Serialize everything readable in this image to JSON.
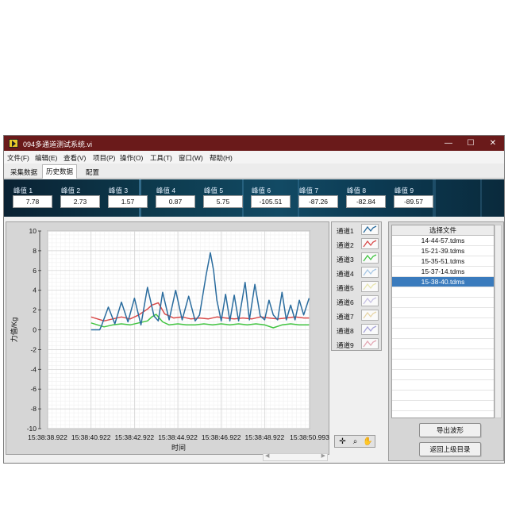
{
  "window": {
    "title": "094多通道测试系统.vi",
    "controls": {
      "minimize": "—",
      "maximize": "☐",
      "close": "✕"
    }
  },
  "menu": [
    "文件(F)",
    "编辑(E)",
    "查看(V)",
    "项目(P)",
    "操作(O)",
    "工具(T)",
    "窗口(W)",
    "帮助(H)"
  ],
  "tabs": [
    {
      "label": "采集数据",
      "active": false
    },
    {
      "label": "历史数据",
      "active": true
    },
    {
      "label": "配置",
      "active": false
    }
  ],
  "peaks": [
    {
      "label": "峰值 1",
      "value": "7.78"
    },
    {
      "label": "峰值 2",
      "value": "2.73"
    },
    {
      "label": "峰值 3",
      "value": "1.57"
    },
    {
      "label": "峰值 4",
      "value": "0.87"
    },
    {
      "label": "峰值 5",
      "value": "5.75"
    },
    {
      "label": "峰值 6",
      "value": "-105.51"
    },
    {
      "label": "峰值 7",
      "value": "-87.26"
    },
    {
      "label": "峰值 8",
      "value": "-82.84"
    },
    {
      "label": "峰值 9",
      "value": "-89.57"
    }
  ],
  "legend": [
    {
      "label": "通道1",
      "color": "#2a6c9e"
    },
    {
      "label": "通道2",
      "color": "#d94b4b"
    },
    {
      "label": "通道3",
      "color": "#42c442"
    },
    {
      "label": "通道4",
      "color": "#a8c8e6"
    },
    {
      "label": "通道5",
      "color": "#e8e6b0"
    },
    {
      "label": "通道6",
      "color": "#c8c2e4"
    },
    {
      "label": "通道7",
      "color": "#e8d6a8"
    },
    {
      "label": "通道8",
      "color": "#a8a4d8"
    },
    {
      "label": "通道9",
      "color": "#e4a8b4"
    }
  ],
  "chart_data": {
    "type": "line",
    "xlabel": "时间",
    "ylabel": "力值/Kg",
    "ylim": [
      -10,
      10
    ],
    "yticks": [
      "10",
      "8",
      "6",
      "4",
      "2",
      "0",
      "-2",
      "-4",
      "-6",
      "-8",
      "-10"
    ],
    "xlim_seconds": [
      0,
      12.071
    ],
    "xtick_labels": [
      "15:38:38.922",
      "15:38:40.922",
      "15:38:42.922",
      "15:38:44.922",
      "15:38:46.922",
      "15:38:48.922",
      "15:38:50.993"
    ],
    "xtick_seconds": [
      0,
      2,
      4,
      6,
      8,
      10,
      12.071
    ],
    "grid": true,
    "series": [
      {
        "name": "通道1",
        "color": "#2a6c9e",
        "x": [
          2.0,
          2.4,
          2.5,
          2.8,
          3.1,
          3.4,
          3.7,
          4.0,
          4.3,
          4.6,
          4.9,
          5.1,
          5.3,
          5.6,
          5.9,
          6.2,
          6.5,
          6.8,
          7.0,
          7.3,
          7.5,
          7.65,
          7.8,
          8.0,
          8.2,
          8.4,
          8.6,
          8.8,
          9.1,
          9.3,
          9.55,
          9.8,
          10.0,
          10.2,
          10.4,
          10.6,
          10.8,
          11.0,
          11.2,
          11.4,
          11.6,
          11.8,
          12.05
        ],
        "y": [
          0,
          0,
          0.5,
          2.3,
          0.6,
          2.8,
          0.8,
          3.2,
          0.5,
          4.3,
          1.4,
          0.9,
          3.8,
          1.0,
          4.0,
          1.0,
          3.4,
          0.9,
          1.5,
          5.5,
          7.8,
          6.0,
          3.0,
          0.9,
          3.6,
          0.9,
          3.5,
          0.9,
          4.8,
          1.0,
          4.6,
          1.4,
          1.0,
          3.0,
          1.5,
          1.0,
          3.8,
          1.0,
          2.5,
          1.0,
          3.0,
          1.5,
          3.2
        ]
      },
      {
        "name": "通道2",
        "color": "#d94b4b",
        "x": [
          2.0,
          2.3,
          2.6,
          3.0,
          3.4,
          3.8,
          4.2,
          4.6,
          4.8,
          5.1,
          5.4,
          5.8,
          6.2,
          6.6,
          7.0,
          7.4,
          7.8,
          8.2,
          8.6,
          9.0,
          9.4,
          9.8,
          10.2,
          10.6,
          11.0,
          11.4,
          11.8,
          12.05
        ],
        "y": [
          1.3,
          1.1,
          0.9,
          1.1,
          1.3,
          1.1,
          1.5,
          2.1,
          2.5,
          2.73,
          1.6,
          1.2,
          1.3,
          1.1,
          1.2,
          1.1,
          1.3,
          1.2,
          1.1,
          1.2,
          1.1,
          1.3,
          1.2,
          1.1,
          1.2,
          1.3,
          1.2,
          1.2
        ]
      },
      {
        "name": "通道3",
        "color": "#42c442",
        "x": [
          2.0,
          2.3,
          2.6,
          3.0,
          3.4,
          3.8,
          4.2,
          4.6,
          4.8,
          5.0,
          5.3,
          5.6,
          6.0,
          6.4,
          6.8,
          7.2,
          7.6,
          8.0,
          8.4,
          8.8,
          9.2,
          9.6,
          10.0,
          10.4,
          10.8,
          11.2,
          11.6,
          12.05
        ],
        "y": [
          0.7,
          0.5,
          0.3,
          0.5,
          0.6,
          0.5,
          0.7,
          0.9,
          1.3,
          1.57,
          0.8,
          0.5,
          0.6,
          0.5,
          0.5,
          0.6,
          0.5,
          0.6,
          0.5,
          0.6,
          0.5,
          0.6,
          0.5,
          0.2,
          0.5,
          0.6,
          0.5,
          0.5
        ]
      }
    ]
  },
  "files": {
    "header": "选择文件",
    "items": [
      "14-44-57.tdms",
      "15-21-39.tdms",
      "15-35-51.tdms",
      "15-37-14.tdms",
      "15-38-40.tdms"
    ],
    "selected_index": 4
  },
  "buttons": {
    "export": "导出波形",
    "back": "返回上级目录"
  }
}
